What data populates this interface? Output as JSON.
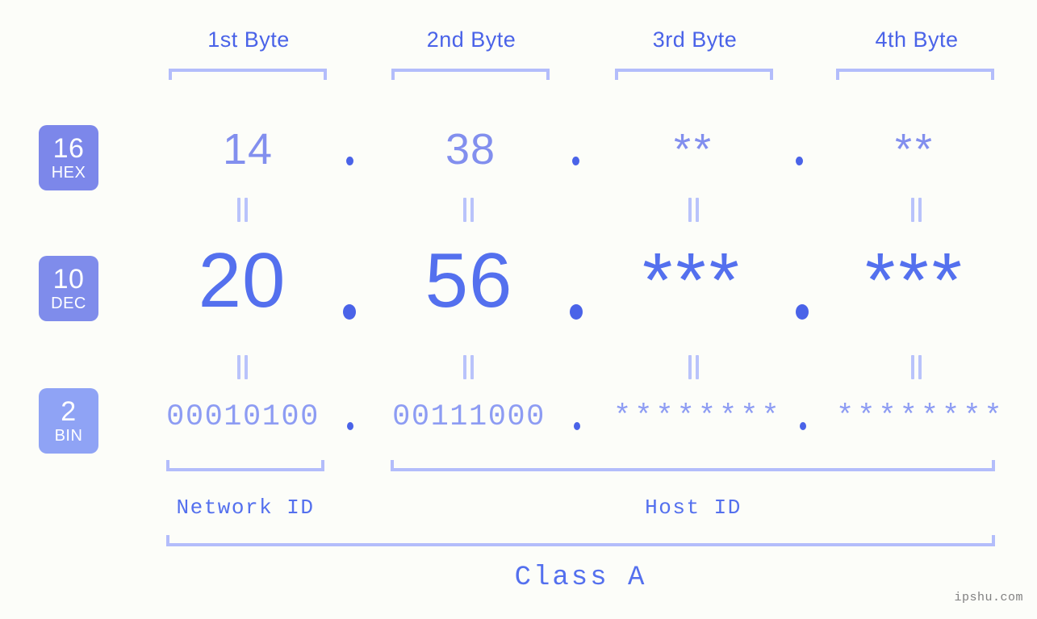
{
  "meta": {
    "background": "#fcfdf9",
    "accent_strong": "#4a63e8",
    "accent_mid": "#5470ee",
    "accent_light": "#8d9cf3",
    "bracket_color": "#b3bdfb"
  },
  "byte_headers": [
    {
      "label": "1st Byte"
    },
    {
      "label": "2nd Byte"
    },
    {
      "label": "3rd Byte"
    },
    {
      "label": "4th Byte"
    }
  ],
  "bases": [
    {
      "num": "16",
      "name": "HEX",
      "color": "#7c87ea"
    },
    {
      "num": "10",
      "name": "DEC",
      "color": "#7f8ceb"
    },
    {
      "num": "2",
      "name": "BIN",
      "color": "#8fa3f5"
    }
  ],
  "rows": {
    "hex": {
      "values": [
        "14",
        "38",
        "**",
        "**"
      ]
    },
    "dec": {
      "values": [
        "20",
        "56",
        "***",
        "***"
      ]
    },
    "bin": {
      "values": [
        "00010100",
        "00111000",
        "********",
        "********"
      ]
    }
  },
  "separators": {
    "dot": "."
  },
  "equals": {
    "symbol": "="
  },
  "id_sections": [
    {
      "label": "Network ID"
    },
    {
      "label": "Host ID"
    }
  ],
  "class_label": "Class A",
  "watermark": "ipshu.com"
}
